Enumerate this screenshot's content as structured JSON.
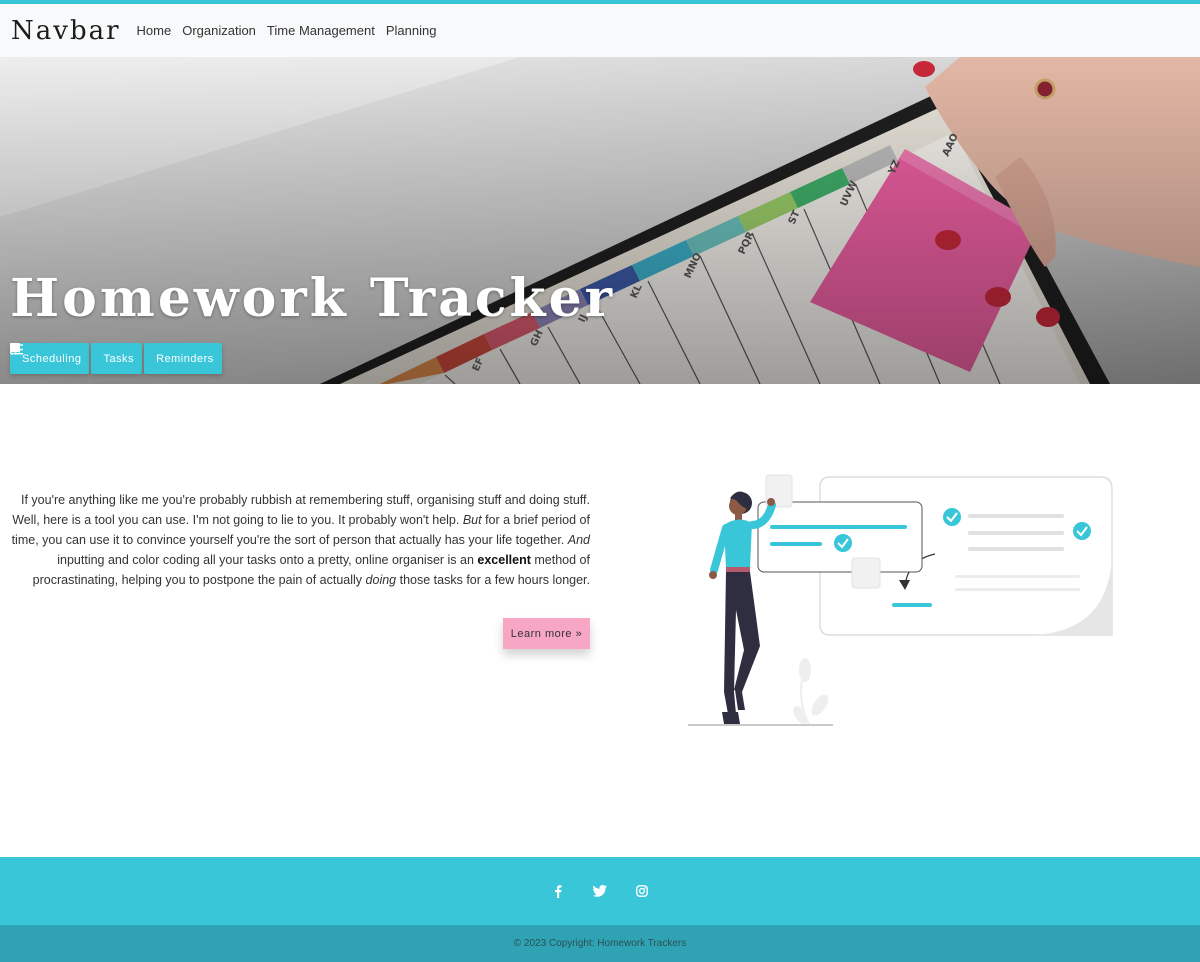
{
  "navbar": {
    "brand": "Navbar",
    "links": [
      "Home",
      "Organization",
      "Time Management",
      "Planning"
    ]
  },
  "hero": {
    "title": "Homework Tracker",
    "buttons": [
      {
        "label": "Scheduling",
        "icon": "book-icon"
      },
      {
        "label": "Tasks",
        "icon": "checklist-icon"
      },
      {
        "label": "Reminders",
        "icon": "bell-icon"
      }
    ],
    "tabs": [
      "EF",
      "GH",
      "IJ",
      "KL",
      "MNO",
      "PQR",
      "ST",
      "UVW",
      "YZ",
      "AAO"
    ]
  },
  "intro": {
    "p1": "If you're anything like me you're probably rubbish at remembering stuff, organising stuff and doing stuff. Well, here is a tool you can use. I'm not going to lie to you. It probably won't help. ",
    "but": "But",
    "p2": " for a brief period of time, you can use it to convince yourself you're the sort of person that actually has your life together. ",
    "and": "And",
    "p3": " inputting and color coding all your tasks onto a pretty, online organiser is an ",
    "excellent": "excellent",
    "p4": " method of procrastinating, helping you to postpone the pain of actually ",
    "doing": "doing",
    "p5": " those tasks for a few hours longer.",
    "button": "Learn more »"
  },
  "footer": {
    "social": [
      "facebook-icon",
      "twitter-icon",
      "instagram-icon"
    ],
    "copyright": "© 2023 Copyright: Homework Trackers"
  },
  "colors": {
    "accent": "#39c6d9",
    "accent_dark": "#2fa3b3",
    "pink": "#f7a6c4"
  }
}
